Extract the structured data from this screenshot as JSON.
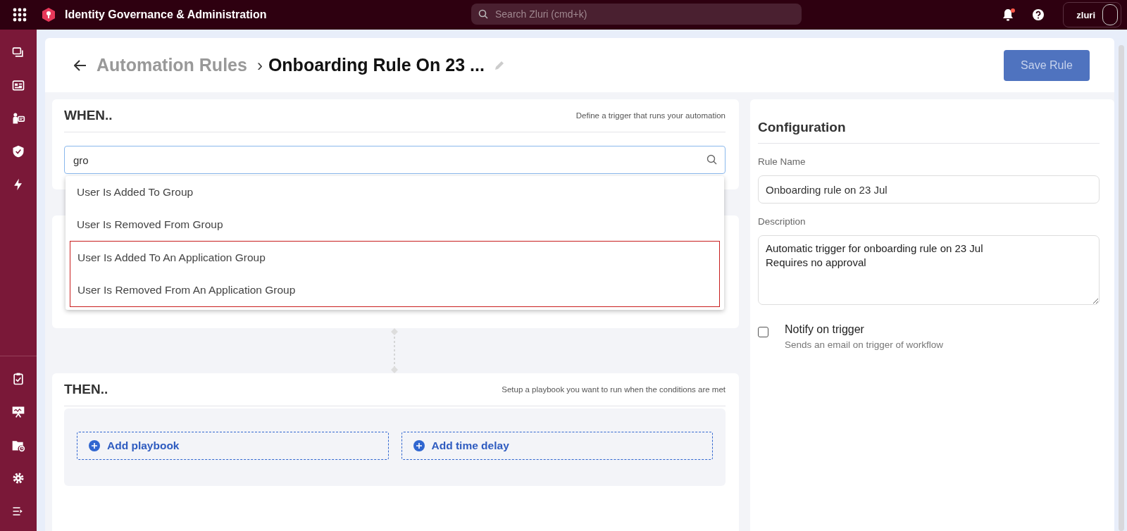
{
  "topbar": {
    "app_title": "Identity Governance & Administration",
    "search": {
      "placeholder": "Search Zluri (cmd+k)"
    },
    "notification_badge": true,
    "brand": "zluri"
  },
  "header": {
    "breadcrumb_parent": "Automation Rules",
    "separator": "›",
    "title": "Onboarding Rule On 23 ...",
    "save_button": {
      "label": "Save Rule",
      "disabled": true
    }
  },
  "when": {
    "heading": "WHEN..",
    "hint": "Define a trigger that runs your automation",
    "search": {
      "value": "gro"
    },
    "options": [
      {
        "label": "User Is Added To Group",
        "highlighted": false
      },
      {
        "label": "User Is Removed From Group",
        "highlighted": false
      },
      {
        "label": "User Is Added To An Application Group",
        "highlighted": true
      },
      {
        "label": "User Is Removed From An Application Group",
        "highlighted": true
      }
    ]
  },
  "then": {
    "heading": "THEN..",
    "hint": "Setup a playbook you want to run when the conditions are met",
    "actions": [
      "Add playbook",
      "Add time delay"
    ]
  },
  "configuration": {
    "heading": "Configuration",
    "rule_name_label": "Rule Name",
    "rule_name": "Onboarding rule on 23 Jul",
    "description_label": "Description",
    "description": "Automatic trigger for onboarding rule on 23 Jul\nRequires no approval",
    "notify": {
      "label": "Notify on trigger",
      "hint": "Sends an email on trigger of workflow",
      "checked": false
    }
  }
}
